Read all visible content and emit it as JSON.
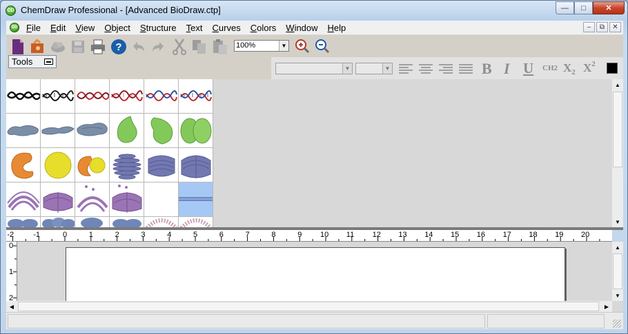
{
  "window": {
    "title": "ChemDraw Professional - [Advanced BioDraw.ctp]",
    "app_icon_text": "CD",
    "controls": [
      "minimize-icon",
      "maximize-icon",
      "close-icon"
    ]
  },
  "menubar": {
    "items": [
      "File",
      "Edit",
      "View",
      "Object",
      "Structure",
      "Text",
      "Curves",
      "Colors",
      "Window",
      "Help"
    ],
    "mdi_controls": [
      "minimize-icon",
      "restore-icon",
      "close-icon"
    ]
  },
  "toolbar": {
    "buttons": [
      "new-document-icon",
      "open-icon",
      "online-icon",
      "save-icon",
      "print-icon",
      "help-icon",
      "undo-icon",
      "redo-icon",
      "cut-icon",
      "copy-icon",
      "paste-icon"
    ],
    "zoom_value": "100%",
    "zoom_in": "zoom-in-icon",
    "zoom_out": "zoom-out-icon"
  },
  "tools_panel": {
    "label": "Tools"
  },
  "text_toolbar": {
    "font_value": "",
    "size_value": "",
    "bold": "B",
    "italic": "I",
    "underline": "U",
    "formula": "CH2",
    "subscript": "X2",
    "superscript": "X2",
    "color": "#000000"
  },
  "palette": {
    "rows": [
      [
        "dna-double-helix-black",
        "dna-helix-black-2",
        "rna-helix-red",
        "dna-helix-red",
        "dna-helix-red-blue",
        "dna-helix-red-blue-2"
      ],
      [
        "grey-membrane-1",
        "grey-membrane-2",
        "grey-membrane-3",
        "green-cell",
        "green-cell-2",
        "green-cell-3"
      ],
      [
        "orange-protein",
        "yellow-sphere",
        "orange-yellow-complex",
        "golgi-stack-1",
        "golgi-stack-2",
        "golgi-stack-3"
      ],
      [
        "er-arc-1",
        "er-arc-2",
        "er-arc-3",
        "er-arc-4",
        "empty",
        "membrane-selected"
      ],
      [
        "blue-receptor-1",
        "blue-receptor-2",
        "blue-receptor-3",
        "blue-receptor-4",
        "lipid-bilayer-1",
        "lipid-bilayer-2"
      ]
    ],
    "selected_index": 23
  },
  "ruler": {
    "h_labels": [
      "-2",
      "-1",
      "0",
      "1",
      "2",
      "3",
      "4",
      "5",
      "6",
      "7",
      "8",
      "9",
      "10",
      "11",
      "12",
      "13",
      "14",
      "15",
      "16",
      "17",
      "18",
      "19",
      "20"
    ],
    "v_labels": [
      "0",
      "1",
      "2"
    ]
  }
}
